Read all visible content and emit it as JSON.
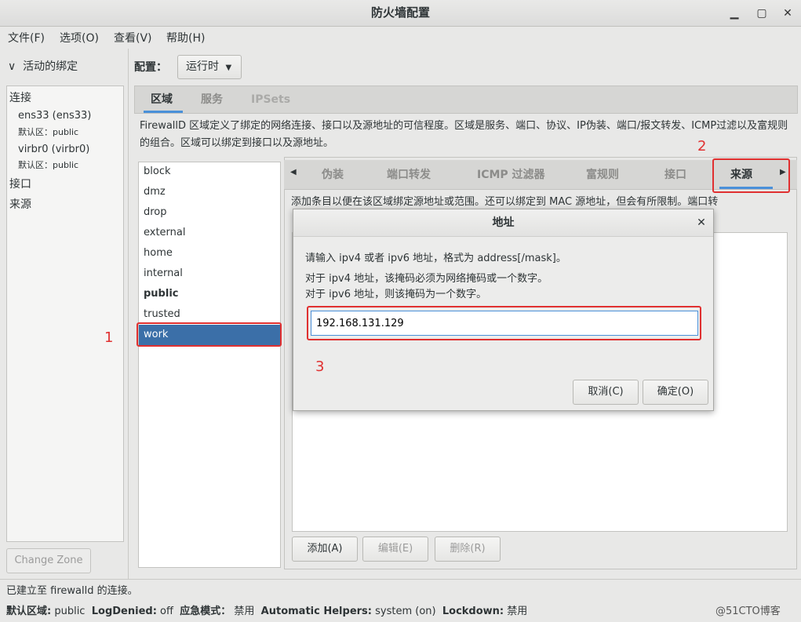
{
  "window": {
    "title": "防火墙配置",
    "minimize": "▁",
    "maximize": "▢",
    "close": "✕"
  },
  "menubar": [
    "文件(F)",
    "选项(O)",
    "查看(V)",
    "帮助(H)"
  ],
  "left": {
    "active_bindings_label": "活动的绑定",
    "connections_label": "连接",
    "connections": [
      {
        "name": "ens33 (ens33)",
        "zone": "默认区：public"
      },
      {
        "name": "virbr0 (virbr0)",
        "zone": "默认区：public"
      }
    ],
    "interfaces_label": "接口",
    "sources_label": "来源",
    "change_zone_button": "Change Zone"
  },
  "config": {
    "label": "配置：",
    "value": "运行时"
  },
  "main_tabs": [
    "区域",
    "服务",
    "IPSets"
  ],
  "zone_description": "FirewallD 区域定义了绑定的网络连接、接口以及源地址的可信程度。区域是服务、端口、协议、IP伪装、端口/报文转发、ICMP过滤以及富规则的组合。区域可以绑定到接口以及源地址。",
  "zones": [
    "block",
    "dmz",
    "drop",
    "external",
    "home",
    "internal",
    "public",
    "trusted",
    "work"
  ],
  "selected_zone": "work",
  "bold_zone": "public",
  "sub_tabs": [
    "伪装",
    "端口转发",
    "ICMP 过滤器",
    "富规则",
    "接口",
    "来源"
  ],
  "active_sub_tab": "来源",
  "sources_description": "添加条目以便在该区域绑定源地址或范围。还可以绑定到 MAC 源地址，但会有所限制。端口转",
  "sources_buttons": {
    "add": "添加(A)",
    "edit": "编辑(E)",
    "remove": "删除(R)"
  },
  "status": {
    "connection": "已建立至 firewalld 的连接。",
    "default_zone_label": "默认区域:",
    "default_zone": "public",
    "log_denied_label": "LogDenied:",
    "log_denied": "off",
    "panic_label": "应急模式：",
    "panic": "禁用",
    "helpers_label": "Automatic Helpers:",
    "helpers": "system (on)",
    "lockdown_label": "Lockdown:",
    "lockdown": "禁用",
    "watermark": "@51CTO博客"
  },
  "dialog": {
    "title": "地址",
    "line1": "请输入 ipv4 或者 ipv6 地址，格式为 address[/mask]。",
    "line2": "对于 ipv4 地址，该掩码必须为网络掩码或一个数字。",
    "line3": "对于 ipv6 地址，则该掩码为一个数字。",
    "input_value": "192.168.131.129",
    "cancel": "取消(C)",
    "ok": "确定(O)"
  },
  "annotations": {
    "n1": "1",
    "n2": "2",
    "n3": "3"
  }
}
